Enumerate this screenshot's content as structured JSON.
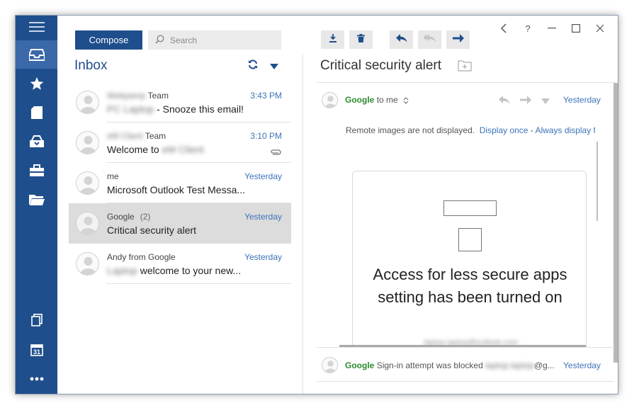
{
  "window": {
    "controls": [
      {
        "name": "back-icon",
        "glyph": "‹"
      },
      {
        "name": "help-icon",
        "glyph": "?"
      },
      {
        "name": "minimize-icon",
        "glyph": "—"
      },
      {
        "name": "maximize-icon",
        "glyph": "☐"
      },
      {
        "name": "close-icon",
        "glyph": "✕"
      }
    ]
  },
  "sidebar": {
    "items": [
      {
        "name": "hamburger-menu-icon",
        "active": false
      },
      {
        "name": "inbox-icon",
        "active": true
      },
      {
        "name": "star-icon",
        "active": false
      },
      {
        "name": "document-icon",
        "active": false
      },
      {
        "name": "archive-icon",
        "active": false
      },
      {
        "name": "toolbox-icon",
        "active": false
      },
      {
        "name": "folder-icon",
        "active": false
      },
      {
        "name": "copy-icon",
        "active": false
      },
      {
        "name": "calendar-icon",
        "active": false,
        "label": "31"
      },
      {
        "name": "more-icon",
        "active": false
      }
    ]
  },
  "list_pane": {
    "compose_label": "Compose",
    "search_placeholder": "Search",
    "folder_title": "Inbox",
    "messages": [
      {
        "sender_blur": "Webpamp",
        "sender": "Team",
        "subject_blur": "PC Laptop",
        "subject": "- Snooze this email!",
        "time": "3:43 PM",
        "selected": false,
        "attachment": false
      },
      {
        "sender_blur": "eM Client",
        "sender": "Team",
        "subject": "Welcome to",
        "subject_blur": "eM Client",
        "time": "3:10 PM",
        "selected": false,
        "attachment": true
      },
      {
        "sender": "me",
        "subject": "Microsoft Outlook Test Messa...",
        "time": "Yesterday",
        "selected": false,
        "attachment": false
      },
      {
        "sender": "Google",
        "count": "(2)",
        "subject": "Critical security alert",
        "time": "Yesterday",
        "selected": true,
        "attachment": false
      },
      {
        "sender": "Andy from Google",
        "subject_blur": "Laptop",
        "subject": "welcome to your new...",
        "time": "Yesterday",
        "selected": false,
        "attachment": false
      }
    ]
  },
  "reading_pane": {
    "title": "Critical security alert",
    "from_name": "Google",
    "to_text": "to me",
    "date": "Yesterday",
    "remote_images_text": "Remote images are not displayed.",
    "display_once": "Display once",
    "separator": "-",
    "always_display": "Always display f",
    "card_heading": "Access for less secure apps setting has been turned on",
    "card_blur": "laptop.laptop@outlook.com",
    "thread": {
      "from_name": "Google",
      "subject": "Sign-in attempt was blocked",
      "email_blur": "laptop.laptop",
      "email_suffix": "@g...",
      "date": "Yesterday"
    }
  }
}
